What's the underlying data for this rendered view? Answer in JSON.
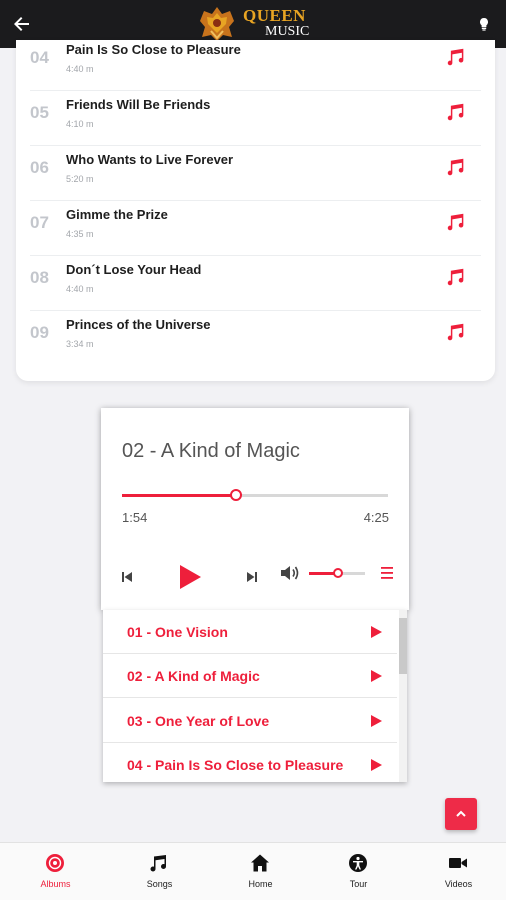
{
  "header": {
    "back_icon": "arrow-left-icon",
    "logo_line1": "QUEEN",
    "logo_line2": "MUSIC",
    "bulb_icon": "lightbulb-icon"
  },
  "songs": [
    {
      "num": "04",
      "title": "Pain Is So Close to Pleasure",
      "duration": "4:40 m"
    },
    {
      "num": "05",
      "title": "Friends Will Be Friends",
      "duration": "4:10 m"
    },
    {
      "num": "06",
      "title": "Who Wants to Live Forever",
      "duration": "5:20 m"
    },
    {
      "num": "07",
      "title": "Gimme the Prize",
      "duration": "4:35 m"
    },
    {
      "num": "08",
      "title": "Don´t Lose Your Head",
      "duration": "4:40 m"
    },
    {
      "num": "09",
      "title": "Princes of the Universe",
      "duration": "3:34 m"
    }
  ],
  "player": {
    "track_title": "02 - A Kind of Magic",
    "current_time": "1:54",
    "total_time": "4:25",
    "progress": 0.43,
    "volume": 0.52
  },
  "playlist": [
    {
      "label": "01 - One Vision"
    },
    {
      "label": "02 - A Kind of Magic"
    },
    {
      "label": "03 - One Year of Love"
    },
    {
      "label": "04 - Pain Is So Close to Pleasure"
    }
  ],
  "nav": [
    {
      "label": "Albums",
      "icon": "album-disc-icon",
      "active": true
    },
    {
      "label": "Songs",
      "icon": "music-note-icon",
      "active": false
    },
    {
      "label": "Home",
      "icon": "home-icon",
      "active": false
    },
    {
      "label": "Tour",
      "icon": "tour-person-icon",
      "active": false
    },
    {
      "label": "Videos",
      "icon": "video-camera-icon",
      "active": false
    }
  ],
  "colors": {
    "accent": "#ee1f3b",
    "topbar": "#1b1b1d",
    "logo_gold": "#e8a423"
  }
}
